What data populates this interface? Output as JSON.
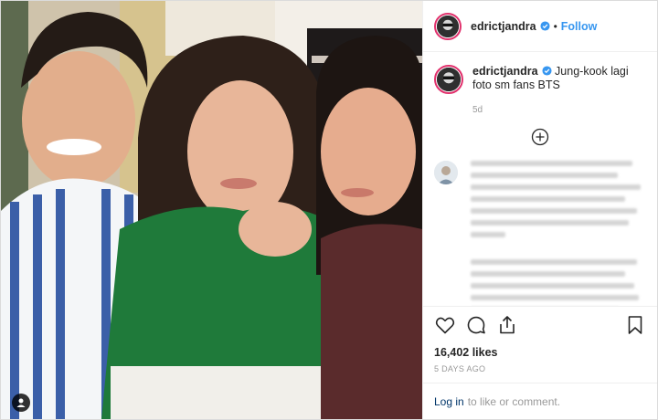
{
  "post": {
    "username": "edrictjandra",
    "follow_label": "Follow",
    "separator": "•",
    "caption_text": "Jung-kook lagi foto sm fans BTS",
    "caption_time": "5d",
    "likes": "16,402 likes",
    "date": "5 DAYS AGO",
    "login_link": "Log in",
    "login_suffix": "to like or comment."
  },
  "icons": {
    "verified": "verified-badge-icon",
    "load_more": "plus-circle-icon",
    "like": "heart-icon",
    "comment": "comment-icon",
    "share": "share-icon",
    "save": "bookmark-icon",
    "tag": "person-tag-icon"
  },
  "colors": {
    "follow": "#3897f0",
    "verified": "#3897f0",
    "login": "#003569",
    "muted": "#999999",
    "border": "#efefef"
  }
}
